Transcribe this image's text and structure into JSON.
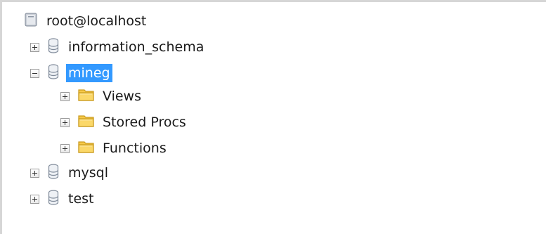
{
  "tree": {
    "root": {
      "label": "root@localhost",
      "icon": "server-icon"
    },
    "databases": [
      {
        "label": "information_schema",
        "icon": "database-icon",
        "expanded": false
      },
      {
        "label": "mineg",
        "icon": "database-icon",
        "expanded": true,
        "selected": true,
        "children": [
          {
            "label": "Views",
            "icon": "folder-icon"
          },
          {
            "label": "Stored Procs",
            "icon": "folder-icon"
          },
          {
            "label": "Functions",
            "icon": "folder-icon"
          }
        ]
      },
      {
        "label": "mysql",
        "icon": "database-icon",
        "expanded": false
      },
      {
        "label": "test",
        "icon": "database-icon",
        "expanded": false
      }
    ]
  },
  "colors": {
    "selection": "#3399ff",
    "folder": "#f7c948",
    "database": "#7f8a99"
  }
}
